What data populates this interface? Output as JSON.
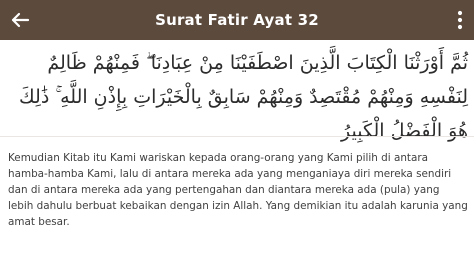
{
  "header": {
    "title": "Surat Fatir Ayat 32",
    "back_icon": "arrow-left-icon",
    "menu_icon": "menu-icon",
    "background": "#5c4a3d",
    "text_color": "#ffffff"
  },
  "verse": {
    "arabic": "ثُمَّ أَوْرَثْنَا الْكِتَابَ الَّذِينَ اصْطَفَيْنَا مِنْ عِبَادِنَا ۖ فَمِنْهُمْ ظَالِمٌ لِنَفْسِهِ وَمِنْهُمْ مُقْتَصِدٌ وَمِنْهُمْ سَابِقٌ بِالْخَيْرَاتِ بِإِذْنِ اللَّهِ ۚ ذَٰلِكَ هُوَ الْفَضْلُ الْكَبِيرُ",
    "translation": "Kemudian Kitab itu Kami wariskan kepada orang-orang yang Kami pilih di antara hamba-hamba Kami, lalu di antara mereka ada yang menganiaya diri mereka sendiri dan di antara mereka ada yang pertengahan dan diantara mereka ada (pula) yang lebih dahulu berbuat kebaikan dengan izin Allah. Yang demikian itu adalah karunia yang amat besar."
  }
}
